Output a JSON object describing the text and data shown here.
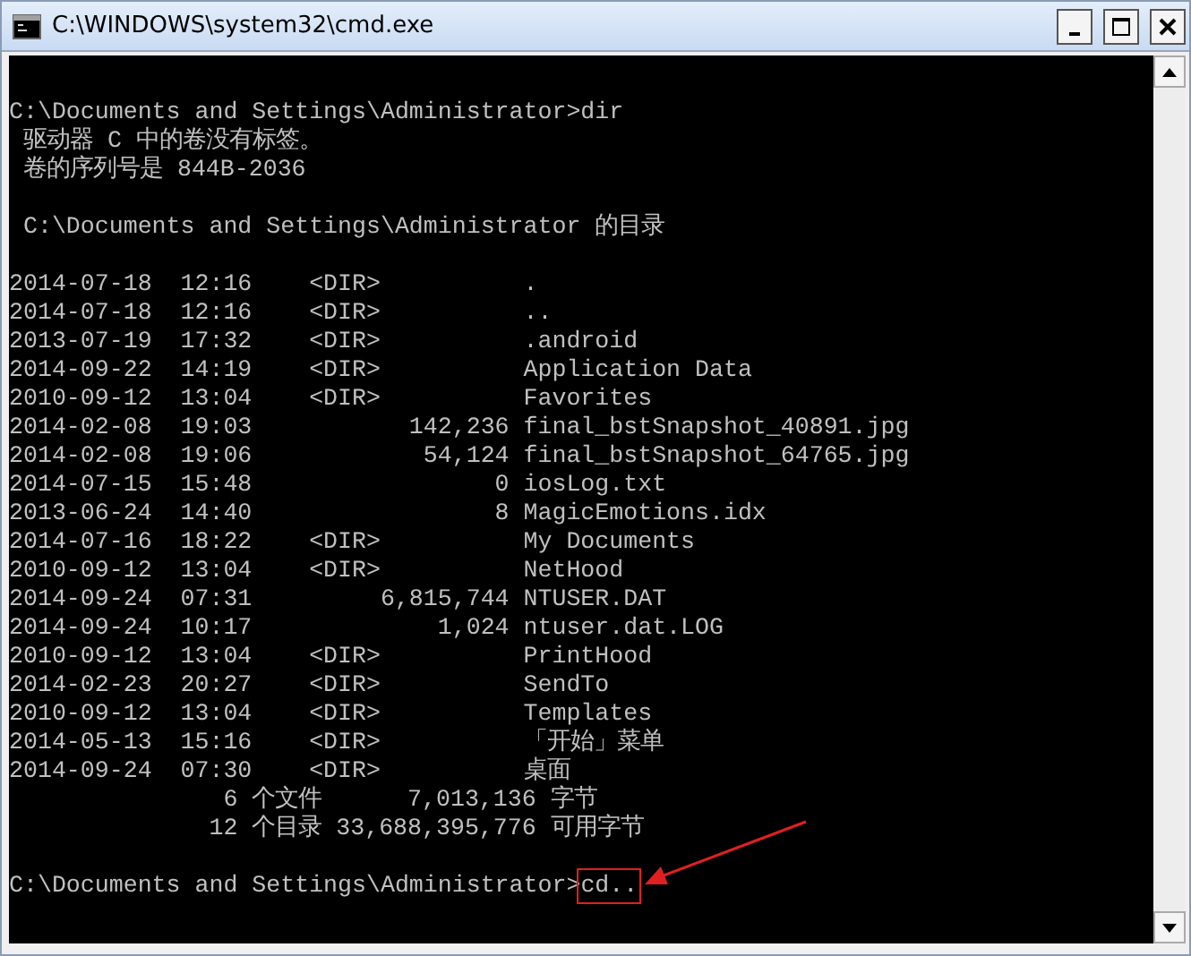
{
  "window": {
    "title": "C:\\WINDOWS\\system32\\cmd.exe"
  },
  "console": {
    "blocks": [
      [
        "C:\\Documents and Settings\\Administrator>dir",
        " 驱动器 C 中的卷没有标签。",
        " 卷的序列号是 844B-2036"
      ],
      [
        " C:\\Documents and Settings\\Administrator 的目录"
      ],
      [
        "2014-07-18  12:16    <DIR>          .",
        "2014-07-18  12:16    <DIR>          ..",
        "2013-07-19  17:32    <DIR>          .android",
        "2014-09-22  14:19    <DIR>          Application Data",
        "2010-09-12  13:04    <DIR>          Favorites",
        "2014-02-08  19:03           142,236 final_bstSnapshot_40891.jpg",
        "2014-02-08  19:06            54,124 final_bstSnapshot_64765.jpg",
        "2014-07-15  15:48                 0 iosLog.txt",
        "2013-06-24  14:40                 8 MagicEmotions.idx",
        "2014-07-16  18:22    <DIR>          My Documents",
        "2010-09-12  13:04    <DIR>          NetHood",
        "2014-09-24  07:31         6,815,744 NTUSER.DAT",
        "2014-09-24  10:17             1,024 ntuser.dat.LOG",
        "2010-09-12  13:04    <DIR>          PrintHood",
        "2014-02-23  20:27    <DIR>          SendTo",
        "2010-09-12  13:04    <DIR>          Templates",
        "2014-05-13  15:16    <DIR>          「开始」菜单",
        "2014-09-24  07:30    <DIR>          桌面",
        "               6 个文件      7,013,136 字节",
        "              12 个目录 33,688,395,776 可用字节"
      ]
    ],
    "prompt": {
      "path": "C:\\Documents and Settings\\Administrator>",
      "command": "cd..",
      "highlighted": true
    }
  }
}
